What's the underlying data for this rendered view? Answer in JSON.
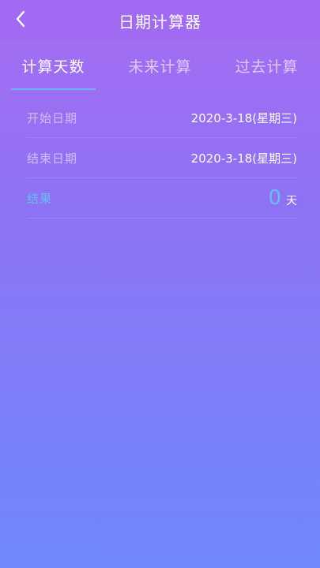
{
  "header": {
    "title": "日期计算器",
    "back_icon": "chevron-left-icon"
  },
  "tabs": [
    {
      "label": "计算天数",
      "active": true
    },
    {
      "label": "未来计算",
      "active": false
    },
    {
      "label": "过去计算",
      "active": false
    }
  ],
  "rows": {
    "start": {
      "label": "开始日期",
      "value": "2020-3-18(星期三)"
    },
    "end": {
      "label": "结束日期",
      "value": "2020-3-18(星期三)"
    },
    "result": {
      "label": "结果",
      "value": "0",
      "unit": "天"
    }
  },
  "colors": {
    "accent": "#62c0f6",
    "tab_underline": "#6fb3f5",
    "background_top": "#a66cf2",
    "background_bottom": "#6f87fb"
  }
}
